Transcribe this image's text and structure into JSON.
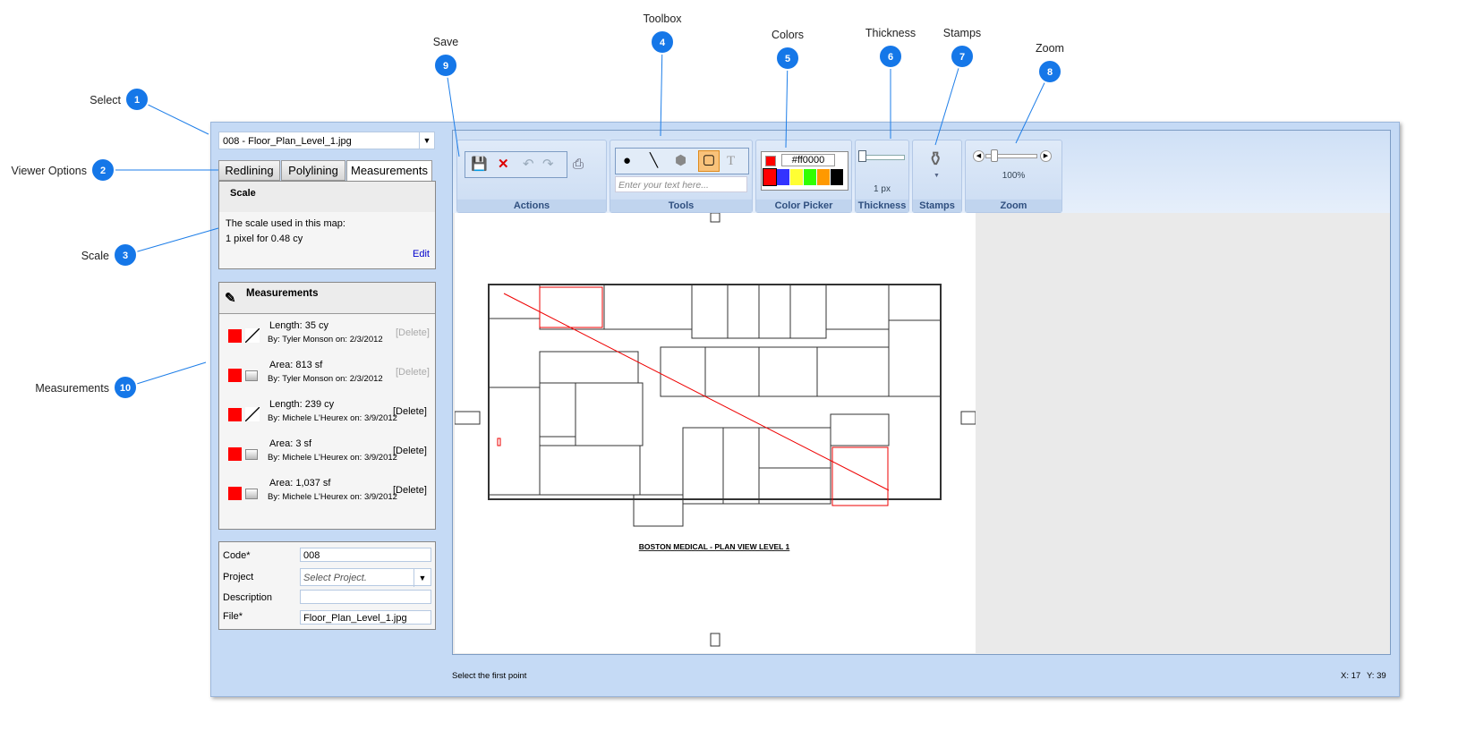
{
  "callouts": [
    {
      "num": "1",
      "label": "Select"
    },
    {
      "num": "2",
      "label": "Viewer Options"
    },
    {
      "num": "3",
      "label": "Scale"
    },
    {
      "num": "4",
      "label": "Toolbox"
    },
    {
      "num": "5",
      "label": "Colors"
    },
    {
      "num": "6",
      "label": "Thickness"
    },
    {
      "num": "7",
      "label": "Stamps"
    },
    {
      "num": "8",
      "label": "Zoom"
    },
    {
      "num": "9",
      "label": "Save"
    },
    {
      "num": "10",
      "label": "Measurements"
    }
  ],
  "file_select": {
    "value": "008 - Floor_Plan_Level_1.jpg"
  },
  "tabs": [
    {
      "label": "Redlining"
    },
    {
      "label": "Polylining"
    },
    {
      "label": "Measurements",
      "active": true
    }
  ],
  "scale": {
    "title": "Scale",
    "line1": "The scale used in this map:",
    "line2": "1 pixel for 0.48 cy",
    "edit": "Edit"
  },
  "measurements": {
    "title": "Measurements",
    "items": [
      {
        "value": "Length: 35  cy",
        "by": "By: Tyler Monson on: 2/3/2012",
        "delete": "[Delete]",
        "type": "line",
        "enabled": false
      },
      {
        "value": "Area: 813  sf",
        "by": "By: Tyler Monson on: 2/3/2012",
        "delete": "[Delete]",
        "type": "area",
        "enabled": false
      },
      {
        "value": "Length: 239  cy",
        "by": "By: Michele L'Heurex on: 3/9/2012",
        "delete": "[Delete]",
        "type": "line",
        "enabled": true
      },
      {
        "value": "Area: 3  sf",
        "by": "By: Michele L'Heurex on: 3/9/2012",
        "delete": "[Delete]",
        "type": "area",
        "enabled": true
      },
      {
        "value": "Area: 1,037  sf",
        "by": "By: Michele L'Heurex on: 3/9/2012",
        "delete": "[Delete]",
        "type": "area",
        "enabled": true
      }
    ]
  },
  "form": {
    "code_label": "Code*",
    "code": "008",
    "project_label": "Project",
    "project_placeholder": "Select Project.",
    "description_label": "Description",
    "description": "",
    "file_label": "File*",
    "file": "Floor_Plan_Level_1.jpg"
  },
  "toolbar": {
    "actions": "Actions",
    "tools": "Tools",
    "text_placeholder": "Enter your text here...",
    "color_picker": "Color Picker",
    "color_hex": "#ff0000",
    "swatches": [
      "#ff0000",
      "#3333ff",
      "#ffff33",
      "#33ff00",
      "#ff9900",
      "#000000"
    ],
    "thickness": "Thickness",
    "thickness_value": "1 px",
    "stamps": "Stamps",
    "zoom": "Zoom",
    "zoom_value": "100%"
  },
  "plan": {
    "title": "BOSTON MEDICAL - PLAN VIEW LEVEL 1"
  },
  "status": {
    "message": "Select the first point",
    "x": "X: 17",
    "y": "Y: 39"
  }
}
